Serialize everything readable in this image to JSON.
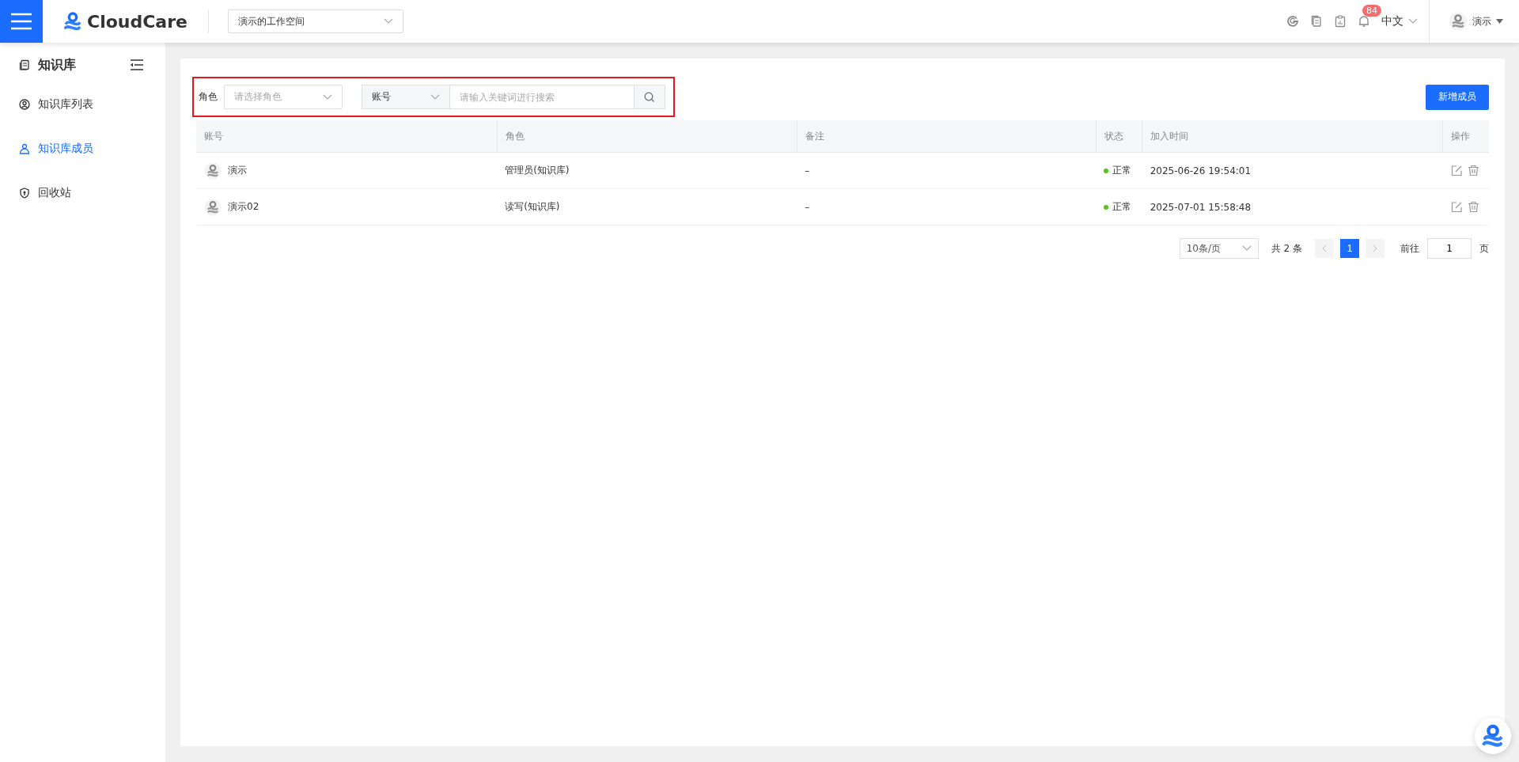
{
  "header": {
    "logo_text": "CloudCare",
    "workspace": "演示的工作空间",
    "notification_count": "84",
    "language": "中文",
    "user": "演示"
  },
  "sidebar": {
    "title": "知识库",
    "items": [
      {
        "label": "知识库列表",
        "kind": "list",
        "selected": false
      },
      {
        "label": "知识库成员",
        "kind": "members",
        "selected": true
      },
      {
        "label": "回收站",
        "kind": "recycle",
        "selected": false
      }
    ]
  },
  "filters": {
    "role_label": "角色",
    "role_placeholder": "请选择角色",
    "field_select": "账号",
    "search_placeholder": "请输入关键词进行搜索"
  },
  "add_button": "新增成员",
  "table": {
    "columns": [
      "账号",
      "角色",
      "备注",
      "状态",
      "加入时间",
      "操作"
    ],
    "rows": [
      {
        "account": "演示",
        "role": "管理员(知识库)",
        "note": "–",
        "status": "正常",
        "color": "#52c41a",
        "joined": "2025-06-26 19:54:01"
      },
      {
        "account": "演示02",
        "role": "读写(知识库)",
        "note": "–",
        "status": "正常",
        "color": "#52c41a",
        "joined": "2025-07-01 15:58:48"
      }
    ]
  },
  "pagination": {
    "page_size": "10条/页",
    "total": "共 2 条",
    "pages": [
      {
        "label": "1",
        "selected": true
      }
    ],
    "goto_label": "前往",
    "goto_value": "1",
    "page_suffix": "页"
  }
}
